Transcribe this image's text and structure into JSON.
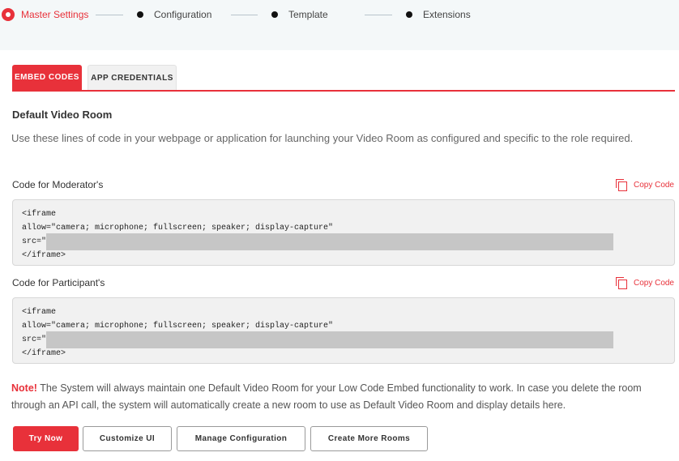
{
  "stepper": {
    "steps": [
      {
        "label": "Master Settings",
        "state": "active"
      },
      {
        "label": "Configuration",
        "state": "pending"
      },
      {
        "label": "Template",
        "state": "pending"
      },
      {
        "label": "Extensions",
        "state": "pending"
      }
    ]
  },
  "tabs": {
    "embed_codes": "EMBED CODES",
    "app_credentials": "APP CREDENTIALS"
  },
  "section": {
    "title": "Default Video Room",
    "description": "Use these lines of code in your webpage or application for launching your Video Room as configured and specific to the role required."
  },
  "moderator": {
    "label": "Code for Moderator's",
    "copy": "Copy Code",
    "lines": [
      "<iframe",
      "allow=\"camera; microphone; fullscreen; speaker; display-capture\"",
      "src=\"",
      "</iframe>"
    ]
  },
  "participant": {
    "label": "Code for Participant's",
    "copy": "Copy Code",
    "lines": [
      "<iframe",
      "allow=\"camera; microphone; fullscreen; speaker; display-capture\"",
      "src=\"",
      "</iframe>"
    ]
  },
  "note": {
    "strong": "Note!",
    "text": " The System will always maintain one Default Video Room for your Low Code Embed functionality to work. In case you delete the room through an API call, the system will automatically create a new room to use as Default Video Room and display details here."
  },
  "buttons": {
    "try_now": "Try Now",
    "customize_ui": "Customize UI",
    "manage_configuration": "Manage Configuration",
    "create_more_rooms": "Create More Rooms"
  },
  "colors": {
    "accent": "#e8313a",
    "stepper_bg": "#f4f8f9",
    "code_bg": "#f1f1f1"
  },
  "icons": {
    "active_step": "step-active-ring-icon",
    "pending_step": "step-dot-icon",
    "copy": "copy-icon"
  }
}
